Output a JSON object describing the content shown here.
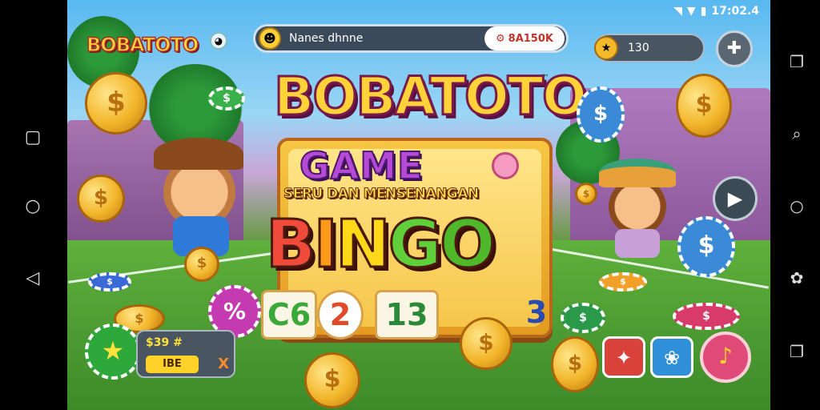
{
  "status_bar": {
    "time": "17:02.4"
  },
  "brand": {
    "logo": "BOBATOTO",
    "title": "BOBATOTO",
    "tm": "™"
  },
  "player": {
    "name": "Nanes dhnne",
    "balance": "8A150K",
    "balance_icon": "⚙"
  },
  "coins": {
    "value": "130"
  },
  "game_board": {
    "game_word": "GAME",
    "tagline": "SERU DAN MENSENANGAN",
    "bingo": [
      "B",
      "I",
      "N",
      "G",
      "O"
    ],
    "numbers": [
      "C6",
      "2",
      "13",
      "3"
    ]
  },
  "level": {
    "line1": "$39 #",
    "line2": "IBE",
    "x_mark": "X"
  },
  "icons": {
    "menu": "puzzle-icon",
    "play": "play-icon",
    "actions": [
      "gift-icon",
      "paw-icon",
      "bell-icon"
    ]
  },
  "colors": {
    "accent": "#ffd23a",
    "bingo_b": "#f04a3a",
    "bingo_o": "#4fb82a",
    "panel": "#4a5562"
  }
}
